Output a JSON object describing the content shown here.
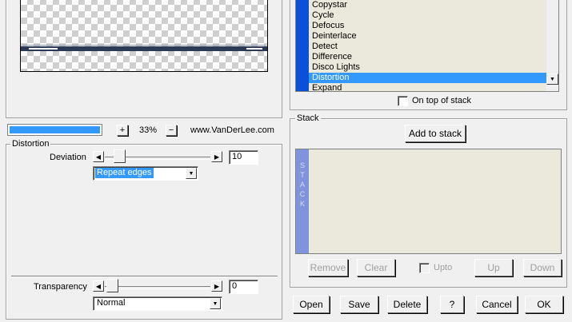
{
  "preview": {
    "zoom_in_label": "+",
    "zoom_value": "33%",
    "zoom_out_label": "−",
    "website": "www.VanDerLee.com"
  },
  "distortion_group": {
    "title": "Distortion",
    "deviation_label": "Deviation",
    "deviation_value": "10",
    "edge_mode": "Repeat edges"
  },
  "transparency": {
    "label": "Transparency",
    "value": "0",
    "blend_mode": "Normal"
  },
  "filter_list": {
    "items": [
      "Copystar",
      "Cycle",
      "Defocus",
      "Deinterlace",
      "Detect",
      "Difference",
      "Disco Lights",
      "Distortion",
      "Expand"
    ],
    "selected": "Distortion",
    "on_top_label": "On top of stack"
  },
  "stack": {
    "title": "Stack",
    "add_label": "Add to stack",
    "side_label": "STACK",
    "remove_label": "Remove",
    "clear_label": "Clear",
    "upto_label": "Upto",
    "up_label": "Up",
    "down_label": "Down"
  },
  "footer": {
    "open_label": "Open",
    "save_label": "Save",
    "delete_label": "Delete",
    "help_label": "?",
    "cancel_label": "Cancel",
    "ok_label": "OK"
  },
  "colors": {
    "selection": "#3399ff",
    "list_bg": "#ebe9db",
    "stack_side": "#7f94dc",
    "scroll_track_blue": "#0a50d8"
  }
}
